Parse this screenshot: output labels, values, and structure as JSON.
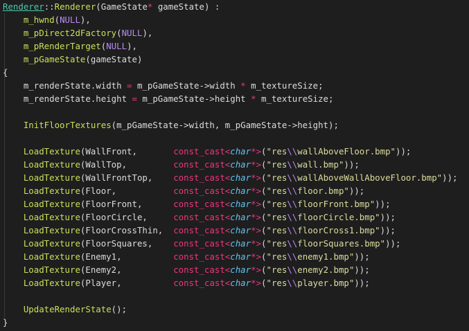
{
  "lines": [
    {
      "y": 0,
      "tokens": [
        {
          "t": "type",
          "v": "Renderer"
        },
        {
          "t": "punc",
          "v": "::"
        },
        {
          "t": "func",
          "v": "Renderer"
        },
        {
          "t": "punc",
          "v": "("
        },
        {
          "t": "plain",
          "v": "GameState"
        },
        {
          "t": "op",
          "v": "*"
        },
        {
          "t": "plain",
          "v": " gameState) :"
        }
      ]
    },
    {
      "y": 1,
      "tokens": [
        {
          "t": "plain",
          "v": "    "
        },
        {
          "t": "field",
          "v": "m_hwnd"
        },
        {
          "t": "punc",
          "v": "("
        },
        {
          "t": "macro",
          "v": "NULL"
        },
        {
          "t": "punc",
          "v": "),"
        }
      ]
    },
    {
      "y": 2,
      "tokens": [
        {
          "t": "plain",
          "v": "    "
        },
        {
          "t": "field",
          "v": "m_pDirect2dFactory"
        },
        {
          "t": "punc",
          "v": "("
        },
        {
          "t": "macro",
          "v": "NULL"
        },
        {
          "t": "punc",
          "v": "),"
        }
      ]
    },
    {
      "y": 3,
      "tokens": [
        {
          "t": "plain",
          "v": "    "
        },
        {
          "t": "field",
          "v": "m_pRenderTarget"
        },
        {
          "t": "punc",
          "v": "("
        },
        {
          "t": "macro",
          "v": "NULL"
        },
        {
          "t": "punc",
          "v": "),"
        }
      ]
    },
    {
      "y": 4,
      "tokens": [
        {
          "t": "plain",
          "v": "    "
        },
        {
          "t": "field",
          "v": "m_pGameState"
        },
        {
          "t": "punc",
          "v": "(gameState)"
        }
      ]
    },
    {
      "y": 5,
      "tokens": [
        {
          "t": "punc",
          "v": "{"
        }
      ]
    },
    {
      "y": 6,
      "tokens": [
        {
          "t": "plain",
          "v": "    m_renderState.width "
        },
        {
          "t": "op",
          "v": "="
        },
        {
          "t": "plain",
          "v": " m_pGameState->width "
        },
        {
          "t": "op",
          "v": "*"
        },
        {
          "t": "plain",
          "v": " m_textureSize;"
        }
      ]
    },
    {
      "y": 7,
      "tokens": [
        {
          "t": "plain",
          "v": "    m_renderState.height "
        },
        {
          "t": "op",
          "v": "="
        },
        {
          "t": "plain",
          "v": " m_pGameState->height "
        },
        {
          "t": "op",
          "v": "*"
        },
        {
          "t": "plain",
          "v": " m_textureSize;"
        }
      ]
    },
    {
      "y": 8,
      "tokens": []
    },
    {
      "y": 9,
      "tokens": [
        {
          "t": "plain",
          "v": "    "
        },
        {
          "t": "func",
          "v": "InitFloorTextures"
        },
        {
          "t": "punc",
          "v": "(m_pGameState->width, m_pGameState->height);"
        }
      ]
    },
    {
      "y": 10,
      "tokens": []
    },
    {
      "y": 11,
      "tokens": [
        {
          "t": "plain",
          "v": "    "
        },
        {
          "t": "func",
          "v": "LoadTexture"
        },
        {
          "t": "punc",
          "v": "(WallFront,       "
        },
        {
          "t": "kw",
          "v": "const_cast"
        },
        {
          "t": "op",
          "v": "<"
        },
        {
          "t": "ptype",
          "v": "char"
        },
        {
          "t": "op",
          "v": "*>"
        },
        {
          "t": "punc",
          "v": "("
        },
        {
          "t": "str",
          "v": "\"res"
        },
        {
          "t": "esc",
          "v": "\\\\"
        },
        {
          "t": "str",
          "v": "wallAboveFloor.bmp\""
        },
        {
          "t": "punc",
          "v": "));"
        }
      ]
    },
    {
      "y": 12,
      "tokens": [
        {
          "t": "plain",
          "v": "    "
        },
        {
          "t": "func",
          "v": "LoadTexture"
        },
        {
          "t": "punc",
          "v": "(WallTop,         "
        },
        {
          "t": "kw",
          "v": "const_cast"
        },
        {
          "t": "op",
          "v": "<"
        },
        {
          "t": "ptype",
          "v": "char"
        },
        {
          "t": "op",
          "v": "*>"
        },
        {
          "t": "punc",
          "v": "("
        },
        {
          "t": "str",
          "v": "\"res"
        },
        {
          "t": "esc",
          "v": "\\\\"
        },
        {
          "t": "str",
          "v": "wall.bmp\""
        },
        {
          "t": "punc",
          "v": "));"
        }
      ]
    },
    {
      "y": 13,
      "tokens": [
        {
          "t": "plain",
          "v": "    "
        },
        {
          "t": "func",
          "v": "LoadTexture"
        },
        {
          "t": "punc",
          "v": "(WallFrontTop,    "
        },
        {
          "t": "kw",
          "v": "const_cast"
        },
        {
          "t": "op",
          "v": "<"
        },
        {
          "t": "ptype",
          "v": "char"
        },
        {
          "t": "op",
          "v": "*>"
        },
        {
          "t": "punc",
          "v": "("
        },
        {
          "t": "str",
          "v": "\"res"
        },
        {
          "t": "esc",
          "v": "\\\\"
        },
        {
          "t": "str",
          "v": "wallAboveWallAboveFloor.bmp\""
        },
        {
          "t": "punc",
          "v": "));"
        }
      ]
    },
    {
      "y": 14,
      "tokens": [
        {
          "t": "plain",
          "v": "    "
        },
        {
          "t": "func",
          "v": "LoadTexture"
        },
        {
          "t": "punc",
          "v": "(Floor,           "
        },
        {
          "t": "kw",
          "v": "const_cast"
        },
        {
          "t": "op",
          "v": "<"
        },
        {
          "t": "ptype",
          "v": "char"
        },
        {
          "t": "op",
          "v": "*>"
        },
        {
          "t": "punc",
          "v": "("
        },
        {
          "t": "str",
          "v": "\"res"
        },
        {
          "t": "esc",
          "v": "\\\\"
        },
        {
          "t": "str",
          "v": "floor.bmp\""
        },
        {
          "t": "punc",
          "v": "));"
        }
      ]
    },
    {
      "y": 15,
      "tokens": [
        {
          "t": "plain",
          "v": "    "
        },
        {
          "t": "func",
          "v": "LoadTexture"
        },
        {
          "t": "punc",
          "v": "(FloorFront,      "
        },
        {
          "t": "kw",
          "v": "const_cast"
        },
        {
          "t": "op",
          "v": "<"
        },
        {
          "t": "ptype",
          "v": "char"
        },
        {
          "t": "op",
          "v": "*>"
        },
        {
          "t": "punc",
          "v": "("
        },
        {
          "t": "str",
          "v": "\"res"
        },
        {
          "t": "esc",
          "v": "\\\\"
        },
        {
          "t": "str",
          "v": "floorFront.bmp\""
        },
        {
          "t": "punc",
          "v": "));"
        }
      ]
    },
    {
      "y": 16,
      "tokens": [
        {
          "t": "plain",
          "v": "    "
        },
        {
          "t": "func",
          "v": "LoadTexture"
        },
        {
          "t": "punc",
          "v": "(FloorCircle,     "
        },
        {
          "t": "kw",
          "v": "const_cast"
        },
        {
          "t": "op",
          "v": "<"
        },
        {
          "t": "ptype",
          "v": "char"
        },
        {
          "t": "op",
          "v": "*>"
        },
        {
          "t": "punc",
          "v": "("
        },
        {
          "t": "str",
          "v": "\"res"
        },
        {
          "t": "esc",
          "v": "\\\\"
        },
        {
          "t": "str",
          "v": "floorCircle.bmp\""
        },
        {
          "t": "punc",
          "v": "));"
        }
      ]
    },
    {
      "y": 17,
      "tokens": [
        {
          "t": "plain",
          "v": "    "
        },
        {
          "t": "func",
          "v": "LoadTexture"
        },
        {
          "t": "punc",
          "v": "(FloorCrossThin,  "
        },
        {
          "t": "kw",
          "v": "const_cast"
        },
        {
          "t": "op",
          "v": "<"
        },
        {
          "t": "ptype",
          "v": "char"
        },
        {
          "t": "op",
          "v": "*>"
        },
        {
          "t": "punc",
          "v": "("
        },
        {
          "t": "str",
          "v": "\"res"
        },
        {
          "t": "esc",
          "v": "\\\\"
        },
        {
          "t": "str",
          "v": "floorCross1.bmp\""
        },
        {
          "t": "punc",
          "v": "));"
        }
      ]
    },
    {
      "y": 18,
      "tokens": [
        {
          "t": "plain",
          "v": "    "
        },
        {
          "t": "func",
          "v": "LoadTexture"
        },
        {
          "t": "punc",
          "v": "(FloorSquares,    "
        },
        {
          "t": "kw",
          "v": "const_cast"
        },
        {
          "t": "op",
          "v": "<"
        },
        {
          "t": "ptype",
          "v": "char"
        },
        {
          "t": "op",
          "v": "*>"
        },
        {
          "t": "punc",
          "v": "("
        },
        {
          "t": "str",
          "v": "\"res"
        },
        {
          "t": "esc",
          "v": "\\\\"
        },
        {
          "t": "str",
          "v": "floorSquares.bmp\""
        },
        {
          "t": "punc",
          "v": "));"
        }
      ]
    },
    {
      "y": 19,
      "tokens": [
        {
          "t": "plain",
          "v": "    "
        },
        {
          "t": "func",
          "v": "LoadTexture"
        },
        {
          "t": "punc",
          "v": "(Enemy1,          "
        },
        {
          "t": "kw",
          "v": "const_cast"
        },
        {
          "t": "op",
          "v": "<"
        },
        {
          "t": "ptype",
          "v": "char"
        },
        {
          "t": "op",
          "v": "*>"
        },
        {
          "t": "punc",
          "v": "("
        },
        {
          "t": "str",
          "v": "\"res"
        },
        {
          "t": "esc",
          "v": "\\\\"
        },
        {
          "t": "str",
          "v": "enemy1.bmp\""
        },
        {
          "t": "punc",
          "v": "));"
        }
      ]
    },
    {
      "y": 20,
      "tokens": [
        {
          "t": "plain",
          "v": "    "
        },
        {
          "t": "func",
          "v": "LoadTexture"
        },
        {
          "t": "punc",
          "v": "(Enemy2,          "
        },
        {
          "t": "kw",
          "v": "const_cast"
        },
        {
          "t": "op",
          "v": "<"
        },
        {
          "t": "ptype",
          "v": "char"
        },
        {
          "t": "op",
          "v": "*>"
        },
        {
          "t": "punc",
          "v": "("
        },
        {
          "t": "str",
          "v": "\"res"
        },
        {
          "t": "esc",
          "v": "\\\\"
        },
        {
          "t": "str",
          "v": "enemy2.bmp\""
        },
        {
          "t": "punc",
          "v": "));"
        }
      ]
    },
    {
      "y": 21,
      "tokens": [
        {
          "t": "plain",
          "v": "    "
        },
        {
          "t": "func",
          "v": "LoadTexture"
        },
        {
          "t": "punc",
          "v": "(Player,          "
        },
        {
          "t": "kw",
          "v": "const_cast"
        },
        {
          "t": "op",
          "v": "<"
        },
        {
          "t": "ptype",
          "v": "char"
        },
        {
          "t": "op",
          "v": "*>"
        },
        {
          "t": "punc",
          "v": "("
        },
        {
          "t": "str",
          "v": "\"res"
        },
        {
          "t": "esc",
          "v": "\\\\"
        },
        {
          "t": "str",
          "v": "player.bmp\""
        },
        {
          "t": "punc",
          "v": "));"
        }
      ]
    },
    {
      "y": 22,
      "tokens": []
    },
    {
      "y": 23,
      "tokens": [
        {
          "t": "plain",
          "v": "    "
        },
        {
          "t": "func",
          "v": "UpdateRenderState"
        },
        {
          "t": "punc",
          "v": "();"
        }
      ]
    },
    {
      "y": 24,
      "tokens": [
        {
          "t": "punc",
          "v": "}"
        }
      ]
    }
  ]
}
